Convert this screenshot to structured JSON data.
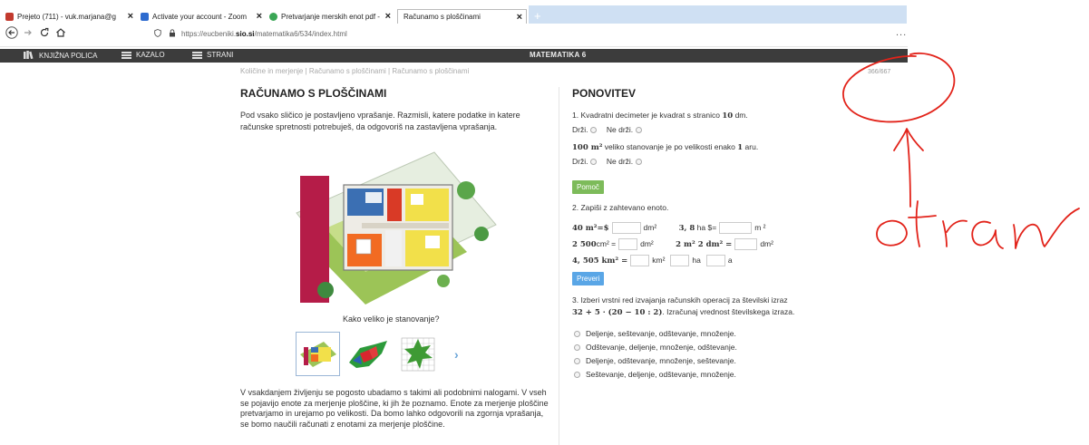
{
  "browser": {
    "tabs": [
      {
        "label": "Prejeto (711) - vuk.marjana@g",
        "color": "#c23a2e"
      },
      {
        "label": "Activate your account - Zoom",
        "color": "#2d6bcf"
      },
      {
        "label": "Pretvarjanje merskih enot pdf -",
        "color": "#3aa655"
      },
      {
        "label": "Računamo s ploščinami",
        "color": ""
      }
    ],
    "new_tab": "+",
    "url_prefix": "https://eucbeniki.",
    "url_domain": "sio.si",
    "url_suffix": "/matematika6/534/index.html",
    "menu_dots": "..."
  },
  "appbar": {
    "bookshelf": "KNJIŽNA POLICA",
    "index": "KAZALO",
    "pages": "STRANI",
    "book_title": "MATEMATIKA 6"
  },
  "breadcrumb": "Količine in merjenje | Računamo s ploščinami | Računamo s ploščinami",
  "page_number": "366/667",
  "left": {
    "title": "RAČUNAMO S PLOŠČINAMI",
    "intro": "Pod vsako sličico je postavljeno vprašanje. Razmisli, katere podatke in katere računske spretnosti potrebuješ, da odgovoriš na zastavljena vprašanja.",
    "image_question": "Kako veliko je stanovanje?",
    "bottom_text": "V vsakdanjem življenju se pogosto ubadamo s takimi ali podobnimi nalogami. V vseh se pojavijo enote za merjenje ploščine, ki jih že poznamo. Enote za merjenje ploščine pretvarjamo in urejamo po velikosti. Da bomo lahko odgovorili na zgornja vprašanja, se bomo naučili računati z enotami za merjenje ploščine."
  },
  "right": {
    "title": "PONOVITEV",
    "q1a_pre": "1. Kvadratni decimeter je kvadrat s stranico ",
    "q1a_num": "10",
    "q1a_post": " dm.",
    "true_label": "Drži.",
    "false_label": "Ne drži.",
    "q1b_pre": "100 m²",
    "q1b_mid": " veliko stanovanje je po velikosti enako ",
    "q1b_num": "1",
    "q1b_post": " aru.",
    "help_btn": "Pomoč",
    "q2": "2. Zapiši z zahtevano enoto.",
    "e1_left": "40 m²=$",
    "e1_unit": "dm²",
    "e2_left": "3, 8",
    "e2_mid": " ha $=",
    "e2_unit": "m ²",
    "e3_left": "2 500",
    "e3_mid": "cm² =",
    "e3_unit": "dm²",
    "e4_left": "2 m² 2 dm² =",
    "e4_unit": "dm²",
    "e5_left": "4, 505 km² =",
    "e5_u1": "km²",
    "e5_u2": "ha",
    "e5_u3": "a",
    "check_btn": "Preveri",
    "q3_line1": "3. Izberi vrstni red izvajanja računskih operacij za številski izraz",
    "q3_expr": "32 + 5 · (20 − 10 : 2)",
    "q3_line2": ". Izračunaj vrednost številskega izraza.",
    "options": [
      "Deljenje, seštevanje, odštevanje, množenje.",
      "Odštevanje, deljenje, množenje, odštevanje.",
      "Deljenje, odštevanje, množenje, seštevanje.",
      "Seštevanje, deljenje, odštevanje, množenje."
    ]
  }
}
